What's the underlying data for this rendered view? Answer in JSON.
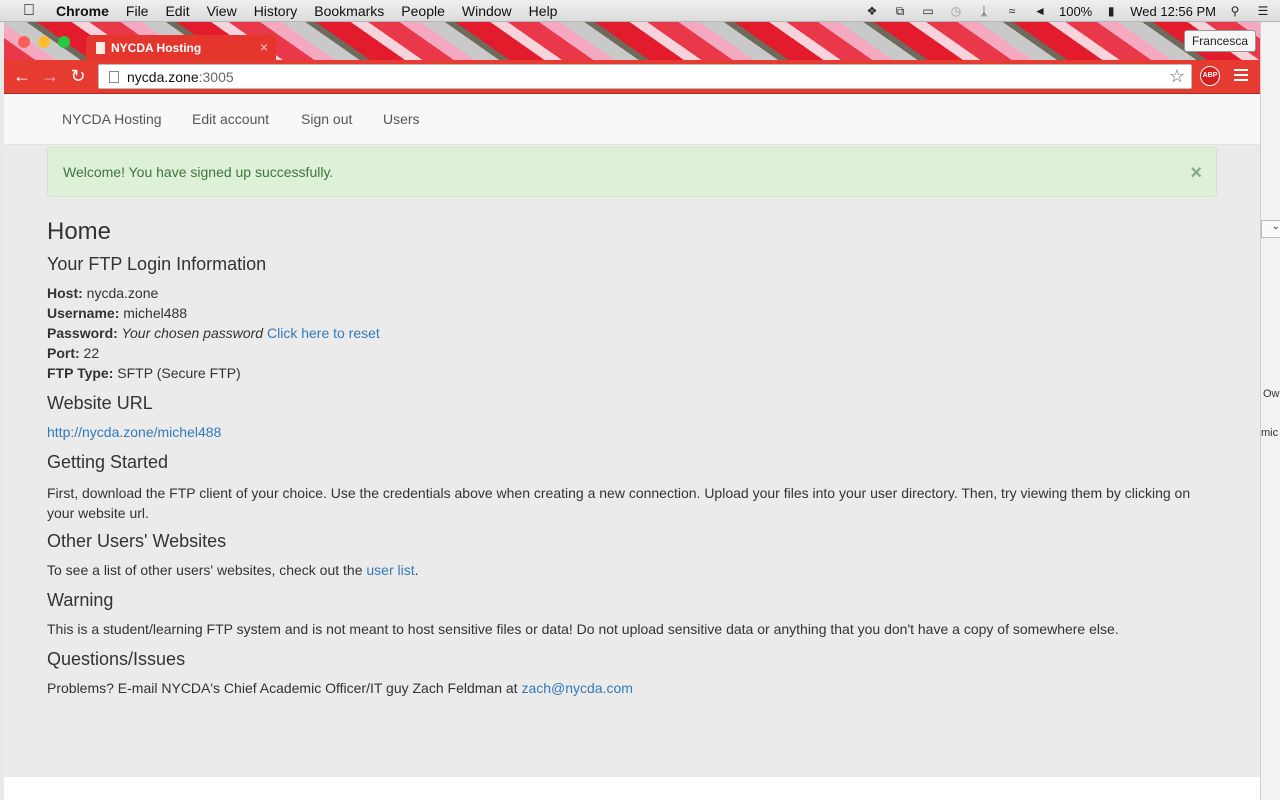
{
  "menubar": {
    "app": "Chrome",
    "items": [
      "File",
      "Edit",
      "View",
      "History",
      "Bookmarks",
      "People",
      "Window",
      "Help"
    ],
    "battery": "100%",
    "clock": "Wed 12:56 PM"
  },
  "browser": {
    "tab_title": "NYCDA Hosting",
    "profile": "Francesca",
    "url_host": "nycda.zone",
    "url_port": ":3005",
    "abp_label": "ABP"
  },
  "nav": {
    "brand": "NYCDA Hosting",
    "links": [
      "Edit account",
      "Sign out",
      "Users"
    ]
  },
  "alert": {
    "message": "Welcome! You have signed up successfully.",
    "close": "×"
  },
  "home": {
    "title": "Home",
    "ftp_heading": "Your FTP Login Information",
    "host_label": "Host:",
    "host_value": " nycda.zone",
    "username_label": "Username:",
    "username_value": " michel488",
    "password_label": "Password:",
    "password_value": " Your chosen password",
    "reset_link": "Click here to reset",
    "port_label": "Port:",
    "port_value": " 22",
    "ftptype_label": "FTP Type:",
    "ftptype_value": " SFTP (Secure FTP)",
    "url_heading": "Website URL",
    "url_link": "http://nycda.zone/michel488",
    "getting_started_heading": "Getting Started",
    "getting_started_text": "First, download the FTP client of your choice. Use the credentials above when creating a new connection. Upload your files into your user directory. Then, try viewing them by clicking on your website url.",
    "other_heading": "Other Users' Websites",
    "other_text_pre": "To see a list of other users' websites, check out the ",
    "other_link": "user list",
    "other_text_post": ".",
    "warning_heading": "Warning",
    "warning_text": "This is a student/learning FTP system and is not meant to host sensitive files or data! Do not upload sensitive data or anything that you don't have a copy of somewhere else.",
    "questions_heading": "Questions/Issues",
    "questions_text": "Problems? E-mail NYCDA's Chief Academic Officer/IT guy Zach Feldman at ",
    "questions_email": "zach@nycda.com"
  },
  "side": {
    "text1": "Own",
    "text2": "mic"
  }
}
